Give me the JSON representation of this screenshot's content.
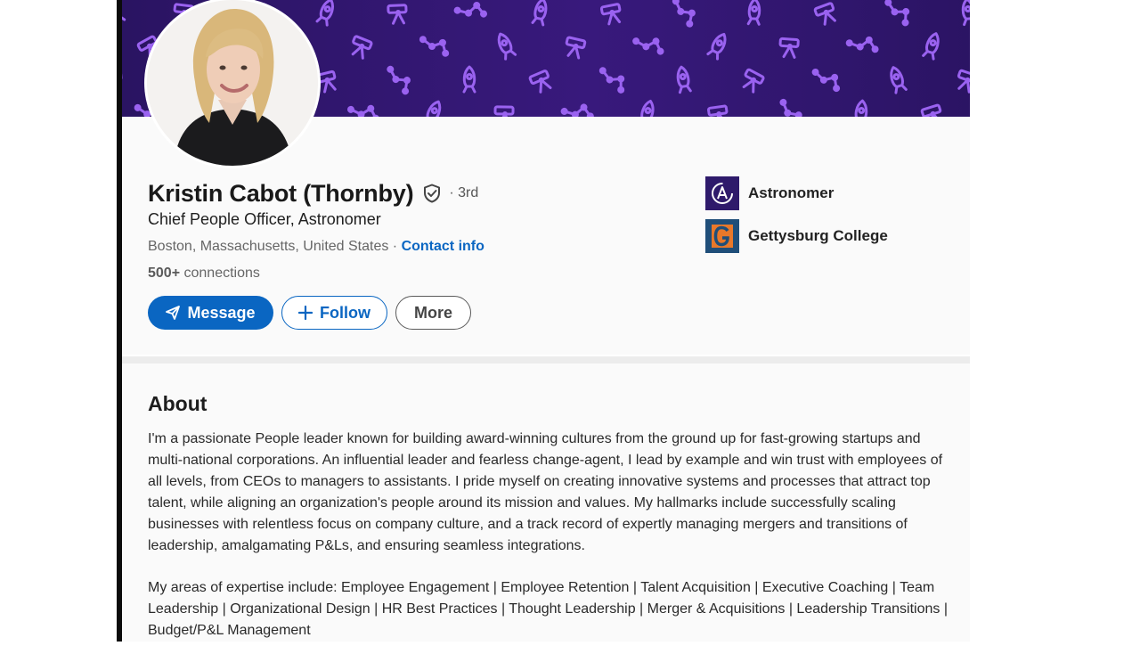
{
  "profile": {
    "name": "Kristin Cabot (Thornby)",
    "degree": "· 3rd",
    "headline": "Chief People Officer, Astronomer",
    "location": "Boston, Massachusetts, United States",
    "separator": " · ",
    "contact_info": "Contact info",
    "connections_count": "500+",
    "connections_label": " connections"
  },
  "actions": {
    "message": "Message",
    "follow": "Follow",
    "more": "More"
  },
  "organizations": [
    {
      "label": "Astronomer",
      "logo_letter": "A",
      "logo_color": "#2e1a6b"
    },
    {
      "label": "Gettysburg College",
      "logo_letter": "G",
      "logo_color": "#1f4e79"
    }
  ],
  "about": {
    "title": "About",
    "paragraphs": [
      "I'm a passionate People leader known for building award-winning cultures from the ground up for fast-growing startups and multi-national corporations. An influential leader and fearless change-agent, I lead by example and win trust with employees of all levels, from CEOs to managers to assistants. I pride myself on creating innovative systems and processes that attract top talent, while aligning an organization's people around its mission and values. My hallmarks include successfully scaling businesses with relentless focus on company culture, and a track record of expertly managing mergers and transitions of leadership, amalgamating P&Ls, and ensuring seamless integrations.",
      "My areas of expertise include: Employee Engagement | Employee Retention | Talent Acquisition | Executive Coaching | Team Leadership | Organizational Design | HR Best Practices | Thought Leadership | Merger & Acquisitions | Leadership Transitions | Budget/P&L Management"
    ]
  },
  "colors": {
    "brand_blue": "#0a66c2",
    "banner_purple": "#38197c",
    "banner_pattern": "#9a62f0"
  },
  "icons": {
    "verify": "shield-check-icon",
    "message": "send-icon",
    "follow": "plus-icon",
    "banner": "rocket-telescope-pattern"
  }
}
